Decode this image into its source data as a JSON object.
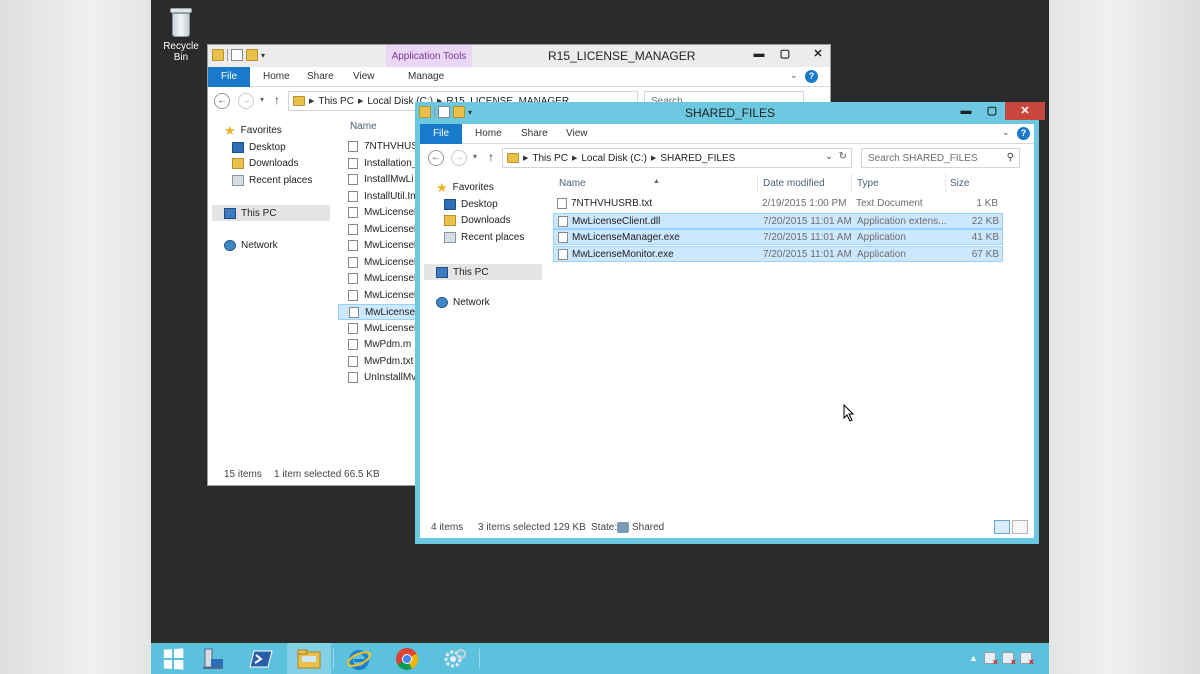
{
  "desktop": {
    "recycle_bin_label": "Recycle Bin"
  },
  "back_window": {
    "title": "R15_LICENSE_MANAGER",
    "application_tools": "Application Tools",
    "tabs": {
      "file": "File",
      "home": "Home",
      "share": "Share",
      "view": "View",
      "manage": "Manage"
    },
    "address": {
      "this_pc": "This PC",
      "local_disk": "Local Disk (C:)",
      "folder": "R15_LICENSE_MANAGER"
    },
    "search_placeholder": "Search R15_LICENSE_MANAG...",
    "nav": {
      "favorites": "Favorites",
      "desktop": "Desktop",
      "downloads": "Downloads",
      "recent": "Recent places",
      "this_pc": "This PC",
      "network": "Network"
    },
    "column_name": "Name",
    "files": [
      "7NTHVHUS",
      "Installation_",
      "InstallMwLi",
      "InstallUtil.In",
      "MwLicensel",
      "MwLicensel",
      "MwLicensel",
      "MwLicensel",
      "MwLicensel",
      "MwLicensel",
      "MwLicensel",
      "MwLicensel",
      "MwPdm.m",
      "MwPdm.txt",
      "UnInstallMv"
    ],
    "status": {
      "items": "15 items",
      "selected": "1 item selected  66.5 KB"
    }
  },
  "front_window": {
    "title": "SHARED_FILES",
    "tabs": {
      "file": "File",
      "home": "Home",
      "share": "Share",
      "view": "View"
    },
    "address": {
      "this_pc": "This PC",
      "local_disk": "Local Disk (C:)",
      "folder": "SHARED_FILES"
    },
    "search_placeholder": "Search SHARED_FILES",
    "nav": {
      "favorites": "Favorites",
      "desktop": "Desktop",
      "downloads": "Downloads",
      "recent": "Recent places",
      "this_pc": "This PC",
      "network": "Network"
    },
    "columns": {
      "name": "Name",
      "date": "Date modified",
      "type": "Type",
      "size": "Size"
    },
    "files": [
      {
        "name": "7NTHVHUSRB.txt",
        "date": "2/19/2015 1:00 PM",
        "type": "Text Document",
        "size": "1 KB"
      },
      {
        "name": "MwLicenseClient.dll",
        "date": "7/20/2015 11:01 AM",
        "type": "Application extens...",
        "size": "22 KB"
      },
      {
        "name": "MwLicenseManager.exe",
        "date": "7/20/2015 11:01 AM",
        "type": "Application",
        "size": "41 KB"
      },
      {
        "name": "MwLicenseMonitor.exe",
        "date": "7/20/2015 11:01 AM",
        "type": "Application",
        "size": "67 KB"
      }
    ],
    "status": {
      "items": "4 items",
      "selected": "3 items selected  129 KB",
      "state_label": "State:",
      "state_value": "Shared"
    }
  },
  "taskbar": {
    "icons": [
      "start-icon",
      "server-manager-icon",
      "powershell-icon",
      "file-explorer-icon",
      "internet-explorer-icon",
      "chrome-icon",
      "settings-icon"
    ]
  }
}
